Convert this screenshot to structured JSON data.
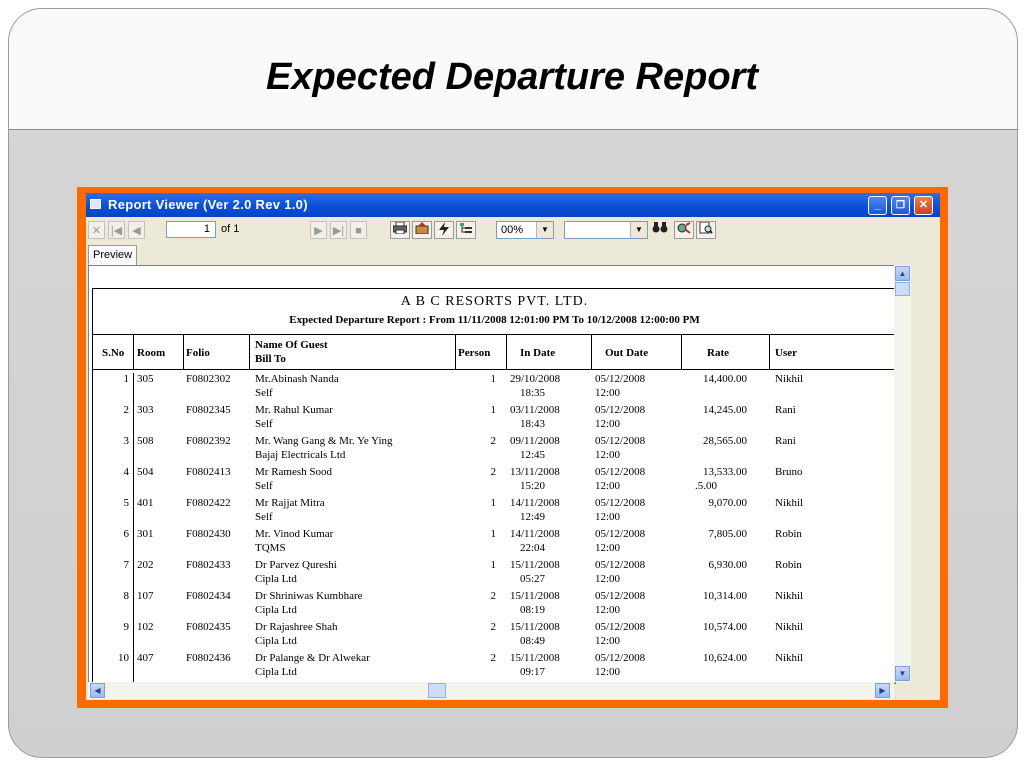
{
  "slide": {
    "title": "Expected Departure Report"
  },
  "window": {
    "title": "Report Viewer (Ver 2.0 Rev 1.0)",
    "minimize": "_",
    "maximize": "❐",
    "close": "✕"
  },
  "toolbar": {
    "page_value": "1",
    "page_of": "of 1",
    "zoom_value": "00%",
    "search_value": ""
  },
  "tabs": [
    {
      "label": "Preview"
    }
  ],
  "report": {
    "company": "A B C RESORTS PVT. LTD.",
    "subtitle": "Expected Departure Report : From 11/11/2008 12:01:00 PM To 10/12/2008 12:00:00 PM",
    "columns": {
      "sno": "S.No",
      "room": "Room",
      "folio": "Folio",
      "guest": "Name Of Guest",
      "billto": "Bill To",
      "person": "Person",
      "indate": "In Date",
      "outdate": "Out Date",
      "rate": "Rate",
      "user": "User"
    },
    "rows": [
      {
        "sno": "1",
        "room": "305",
        "folio": "F0802302",
        "guest": "Mr.Abinash Nanda",
        "billto": "Self",
        "person": "1",
        "in_date": "29/10/2008",
        "in_time": "18:35",
        "out_date": "05/12/2008",
        "out_time": "12:00",
        "rate": "14,400.00",
        "rate2": "",
        "user": "Nikhil"
      },
      {
        "sno": "2",
        "room": "303",
        "folio": "F0802345",
        "guest": "Mr. Rahul Kumar",
        "billto": "Self",
        "person": "1",
        "in_date": "03/11/2008",
        "in_time": "18:43",
        "out_date": "05/12/2008",
        "out_time": "12:00",
        "rate": "14,245.00",
        "rate2": "",
        "user": "Rani"
      },
      {
        "sno": "3",
        "room": "508",
        "folio": "F0802392",
        "guest": "Mr. Wang Gang & Mr. Ye Ying",
        "billto": "Bajaj Electricals Ltd",
        "person": "2",
        "in_date": "09/11/2008",
        "in_time": "12:45",
        "out_date": "05/12/2008",
        "out_time": "12:00",
        "rate": "28,565.00",
        "rate2": "",
        "user": "Rani"
      },
      {
        "sno": "4",
        "room": "504",
        "folio": "F0802413",
        "guest": "Mr Ramesh Sood",
        "billto": "Self",
        "person": "2",
        "in_date": "13/11/2008",
        "in_time": "15:20",
        "out_date": "05/12/2008",
        "out_time": "12:00",
        "rate": "13,533.00",
        "rate2": ".5.00",
        "user": "Bruno"
      },
      {
        "sno": "5",
        "room": "401",
        "folio": "F0802422",
        "guest": "Mr Rajjat Mitra",
        "billto": "Self",
        "person": "1",
        "in_date": "14/11/2008",
        "in_time": "12:49",
        "out_date": "05/12/2008",
        "out_time": "12:00",
        "rate": "9,070.00",
        "rate2": "",
        "user": "Nikhil"
      },
      {
        "sno": "6",
        "room": "301",
        "folio": "F0802430",
        "guest": "Mr. Vinod Kumar",
        "billto": "TQMS",
        "person": "1",
        "in_date": "14/11/2008",
        "in_time": "22:04",
        "out_date": "05/12/2008",
        "out_time": "12:00",
        "rate": "7,805.00",
        "rate2": "",
        "user": "Robin"
      },
      {
        "sno": "7",
        "room": "202",
        "folio": "F0802433",
        "guest": "Dr Parvez Qureshi",
        "billto": "Cipla Ltd",
        "person": "1",
        "in_date": "15/11/2008",
        "in_time": "05:27",
        "out_date": "05/12/2008",
        "out_time": "12:00",
        "rate": "6,930.00",
        "rate2": "",
        "user": "Robin"
      },
      {
        "sno": "8",
        "room": "107",
        "folio": "F0802434",
        "guest": "Dr Shriniwas Kumbhare",
        "billto": "Cipla Ltd",
        "person": "2",
        "in_date": "15/11/2008",
        "in_time": "08:19",
        "out_date": "05/12/2008",
        "out_time": "12:00",
        "rate": "10,314.00",
        "rate2": "",
        "user": "Nikhil"
      },
      {
        "sno": "9",
        "room": "102",
        "folio": "F0802435",
        "guest": "Dr Rajashree Shah",
        "billto": "Cipla Ltd",
        "person": "2",
        "in_date": "15/11/2008",
        "in_time": "08:49",
        "out_date": "05/12/2008",
        "out_time": "12:00",
        "rate": "10,574.00",
        "rate2": "",
        "user": "Nikhil"
      },
      {
        "sno": "10",
        "room": "407",
        "folio": "F0802436",
        "guest": "Dr Palange & Dr Alwekar",
        "billto": "Cipla Ltd",
        "person": "2",
        "in_date": "15/11/2008",
        "in_time": "09:17",
        "out_date": "05/12/2008",
        "out_time": "12:00",
        "rate": "10,624.00",
        "rate2": "",
        "user": "Nikhil"
      }
    ]
  }
}
